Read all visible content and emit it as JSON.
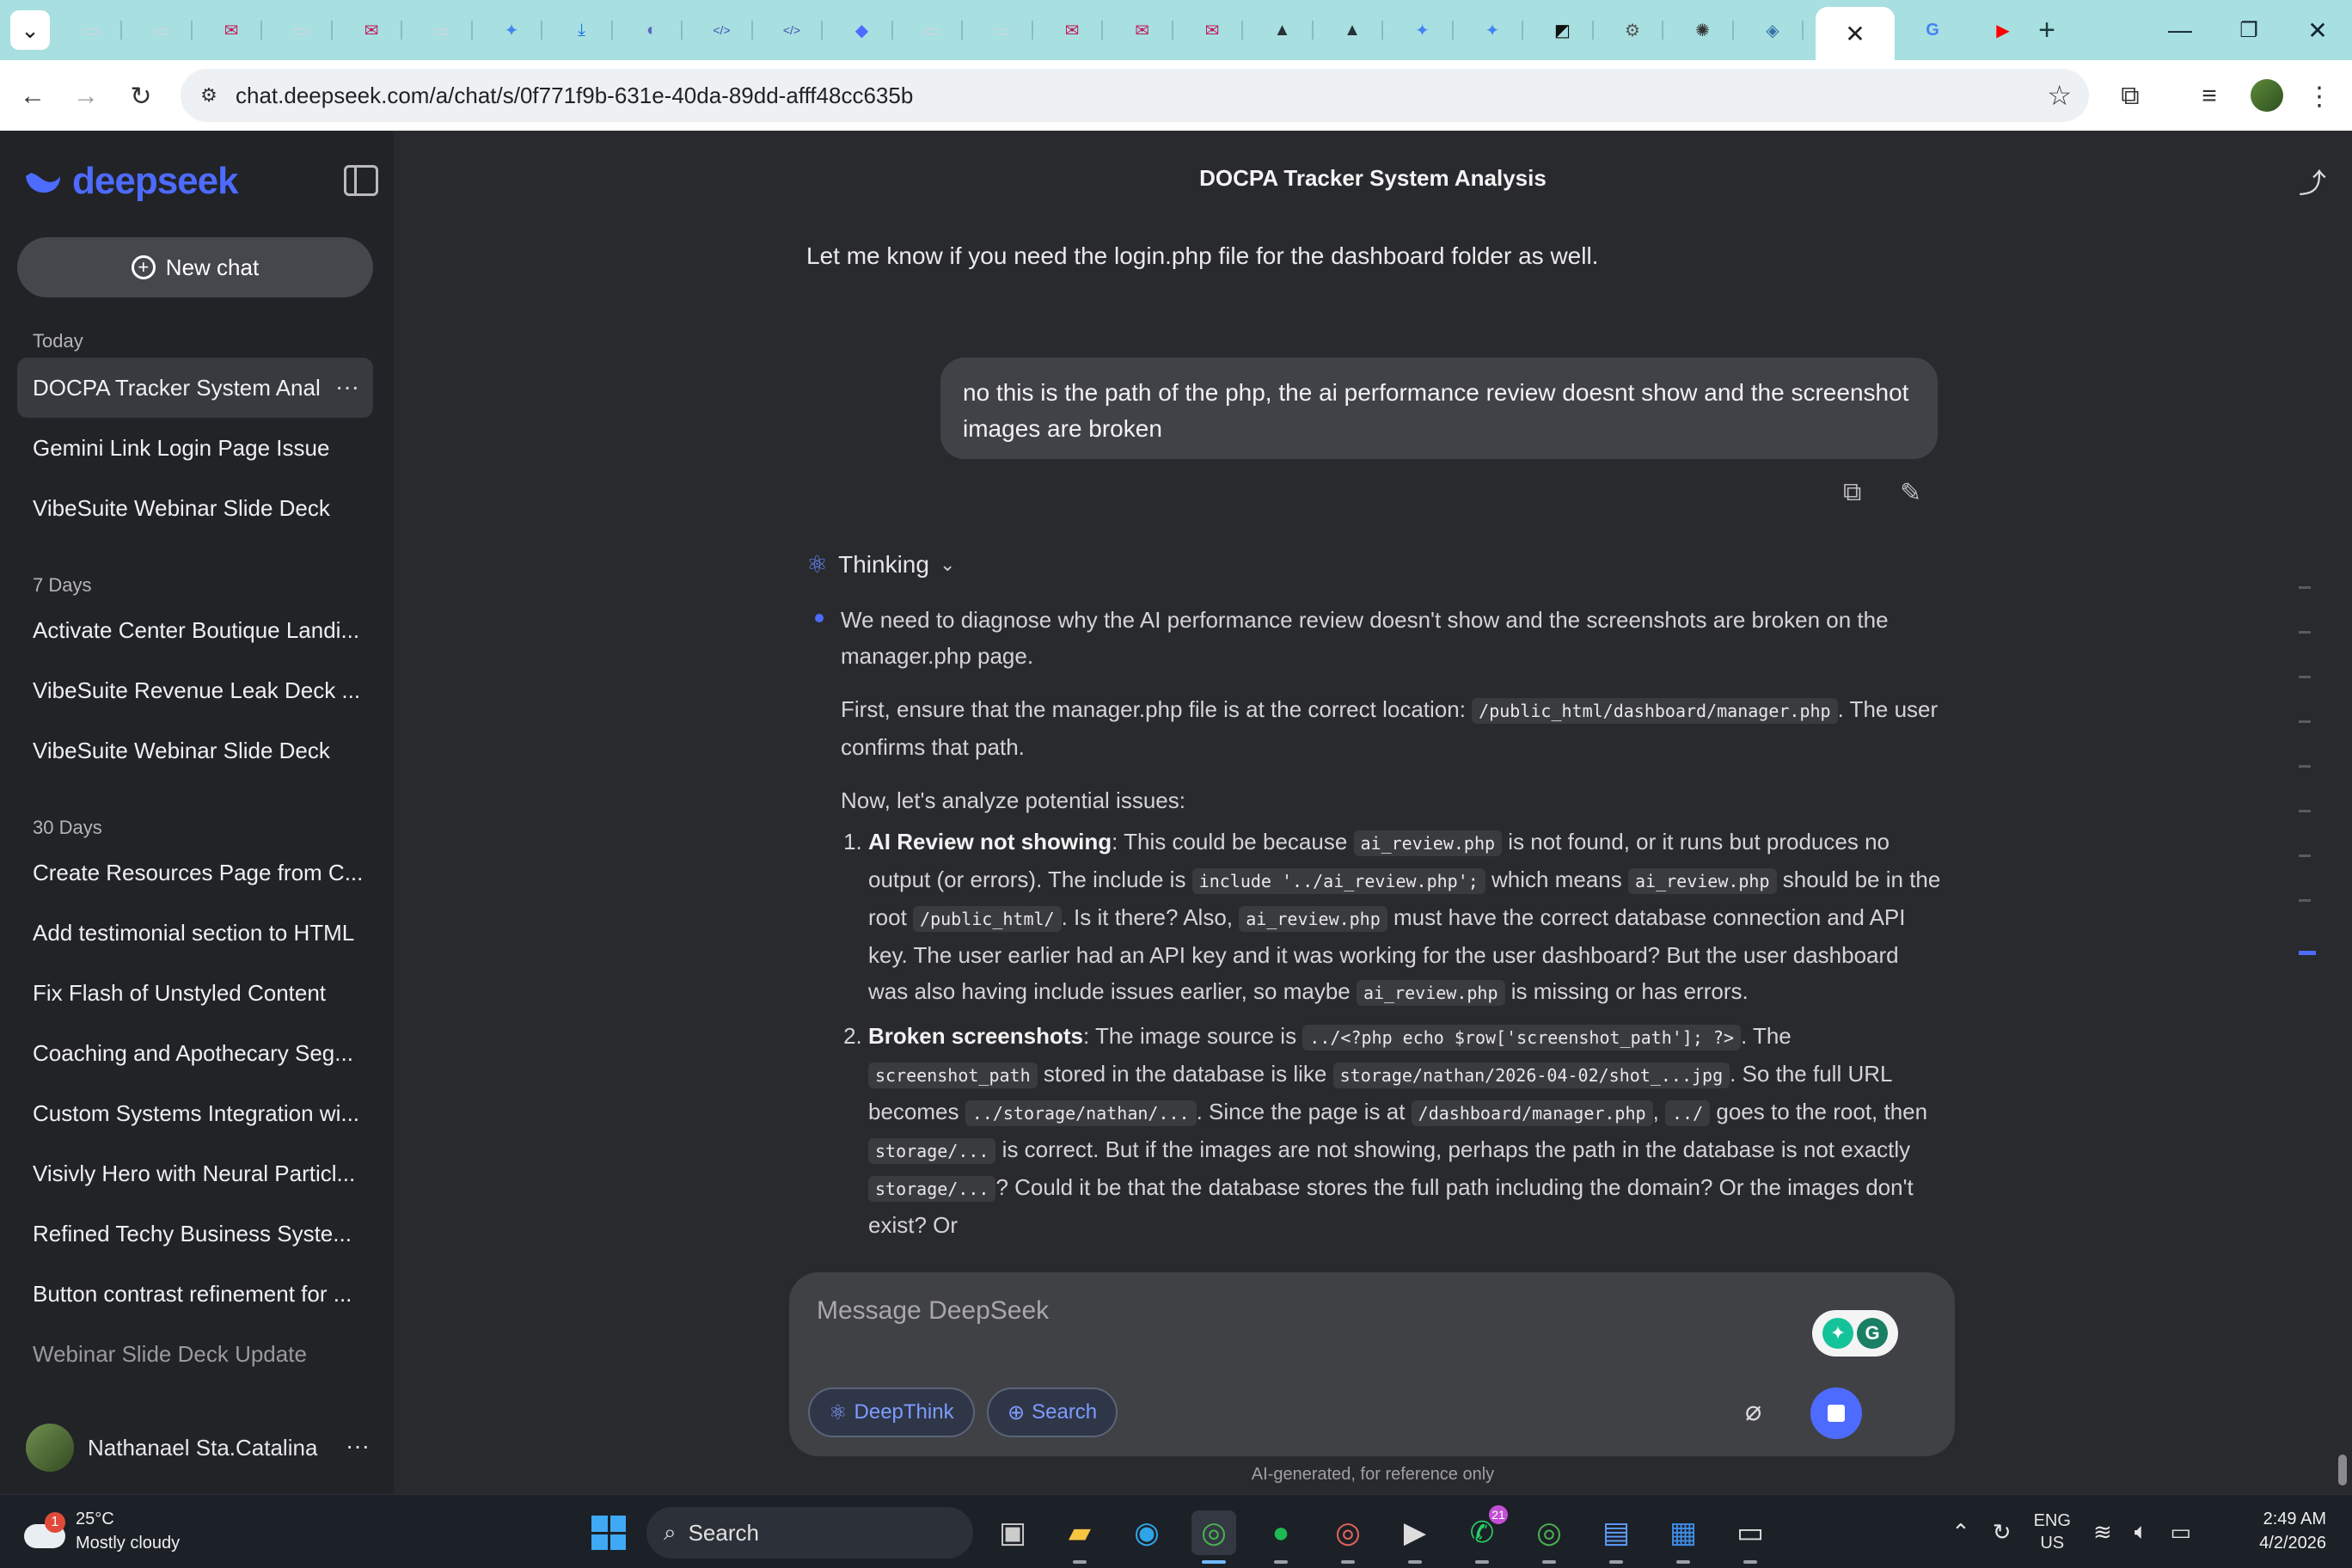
{
  "browser": {
    "url": "chat.deepseek.com/a/chat/s/0f771f9b-631e-40da-89dd-afff48cc635b",
    "tab_count_note": "",
    "tabs": [
      {
        "icon": "generic-page-icon",
        "color": "#d0d6dc"
      },
      {
        "icon": "generic-page-icon",
        "color": "#d0d6dc"
      },
      {
        "icon": "mail-icon",
        "color": "#c2185b"
      },
      {
        "icon": "generic-page-icon",
        "color": "#d0d6dc"
      },
      {
        "icon": "mail-icon",
        "color": "#c2185b"
      },
      {
        "icon": "generic-page-icon",
        "color": "#d0d6dc"
      },
      {
        "icon": "gemini-icon",
        "color": "#4285f4"
      },
      {
        "icon": "download-icon",
        "color": "#1a73e8"
      },
      {
        "icon": "circle-logo-icon",
        "color": "#5c6bc0"
      },
      {
        "icon": "code-icon",
        "color": "#3f51b5"
      },
      {
        "icon": "code-icon",
        "color": "#3f51b5"
      },
      {
        "icon": "deepseek-icon",
        "color": "#4d6bfe"
      },
      {
        "icon": "generic-page-icon",
        "color": "#d0d6dc"
      },
      {
        "icon": "generic-page-icon",
        "color": "#d0d6dc"
      },
      {
        "icon": "mail-icon",
        "color": "#c2185b"
      },
      {
        "icon": "mail-icon",
        "color": "#c2185b"
      },
      {
        "icon": "mail-icon",
        "color": "#c2185b"
      },
      {
        "icon": "vpn-icon",
        "color": "#263238"
      },
      {
        "icon": "vpn-icon",
        "color": "#263238"
      },
      {
        "icon": "gemini-icon",
        "color": "#4285f4"
      },
      {
        "icon": "gemini-icon",
        "color": "#4285f4"
      },
      {
        "icon": "capcut-icon",
        "color": "#111111"
      },
      {
        "icon": "gear-logo-icon",
        "color": "#555555"
      },
      {
        "icon": "openai-icon",
        "color": "#333333"
      },
      {
        "icon": "python-icon",
        "color": "#3572a5"
      }
    ],
    "active_tab_icon": "close-icon",
    "after_tabs": [
      {
        "icon": "google-icon",
        "color": "#4285f4"
      },
      {
        "icon": "youtube-icon",
        "color": "#ff0000"
      }
    ],
    "new_tab_glyph": "+",
    "window_controls": [
      "—",
      "❐",
      "✕"
    ]
  },
  "sidebar": {
    "brand": "deepseek",
    "new_chat_label": "New chat",
    "groups": [
      {
        "label": "Today",
        "items": [
          "DOCPA Tracker System Anal",
          "Gemini Link Login Page Issue",
          "VibeSuite Webinar Slide Deck"
        ]
      },
      {
        "label": "7 Days",
        "items": [
          "Activate Center Boutique Landi...",
          "VibeSuite Revenue Leak Deck ...",
          "VibeSuite Webinar Slide Deck"
        ]
      },
      {
        "label": "30 Days",
        "items": [
          "Create Resources Page from C...",
          "Add testimonial section to HTML",
          "Fix Flash of Unstyled Content",
          "Coaching and Apothecary Seg...",
          "Custom Systems Integration wi...",
          "Visivly Hero with Neural Particl...",
          "Refined Techy Business Syste...",
          "Button contrast refinement for ...",
          "Webinar Slide Deck Update"
        ]
      }
    ],
    "user_name": "Nathanael Sta.Catalina",
    "more_glyph": "···"
  },
  "chat": {
    "title": "DOCPA Tracker System Analysis",
    "previous_reply": "Let me know if you need the login.php file for the dashboard folder as well.",
    "user_message": "no this is the path of the php, the ai performance review doesnt show and the screenshot images are broken",
    "thinking_label": "Thinking",
    "thought": {
      "p1": "We need to diagnose why the AI performance review doesn't show and the screenshots are broken on the manager.php page.",
      "p2_before": "First, ensure that the manager.php file is at the correct location: ",
      "p2_code": "/public_html/dashboard/manager.php",
      "p2_after": ". The user confirms that path.",
      "p3": "Now, let's analyze potential issues:",
      "item1": {
        "title": "AI Review not showing",
        "t1": ": This could be because ",
        "c1": "ai_review.php",
        "t2": " is not found, or it runs but produces no output (or errors). The include is ",
        "c2": "include '../ai_review.php';",
        "t3": " which means ",
        "c3": "ai_review.php",
        "t4": " should be in the root ",
        "c4": "/public_html/",
        "t5": ". Is it there? Also, ",
        "c5": "ai_review.php",
        "t6": " must have the correct database connection and API key. The user earlier had an API key and it was working for the user dashboard? But the user dashboard was also having include issues earlier, so maybe ",
        "c6": "ai_review.php",
        "t7": " is missing or has errors."
      },
      "item2": {
        "title": "Broken screenshots",
        "t1": ": The image source is ",
        "c1": "../<?php echo $row['screenshot_path']; ?>",
        "t2": ". The ",
        "c2": "screenshot_path",
        "t3": " stored in the database is like ",
        "c3": "storage/nathan/2026-04-02/shot_...jpg",
        "t4": ". So the full URL becomes ",
        "c4": "../storage/nathan/...",
        "t5": ". Since the page is at ",
        "c5": "/dashboard/manager.php",
        "t6": ", ",
        "c6": "../",
        "t7": " goes to the root, then ",
        "c7": "storage/...",
        "t8": " is correct. But if the images are not showing, perhaps the path in the database is not exactly ",
        "c8": "storage/...",
        "t9": "? Could it be that the database stores the full path including the domain? Or the images don't exist? Or"
      }
    },
    "composer_placeholder": "Message DeepSeek",
    "deepthink_label": "DeepThink",
    "search_label": "Search",
    "disclaimer": "AI-generated, for reference only"
  },
  "taskbar": {
    "weather_badge": "1",
    "temperature": "25°C",
    "condition": "Mostly cloudy",
    "search_label": "Search",
    "whatsapp_count": "21",
    "lang_line1": "ENG",
    "lang_line2": "US",
    "time": "2:49 AM",
    "date": "4/2/2026"
  },
  "colors": {
    "accent": "#4d6bfe",
    "sidebar_bg": "#212327",
    "main_bg": "#292a2d",
    "bubble_bg": "#414248"
  }
}
